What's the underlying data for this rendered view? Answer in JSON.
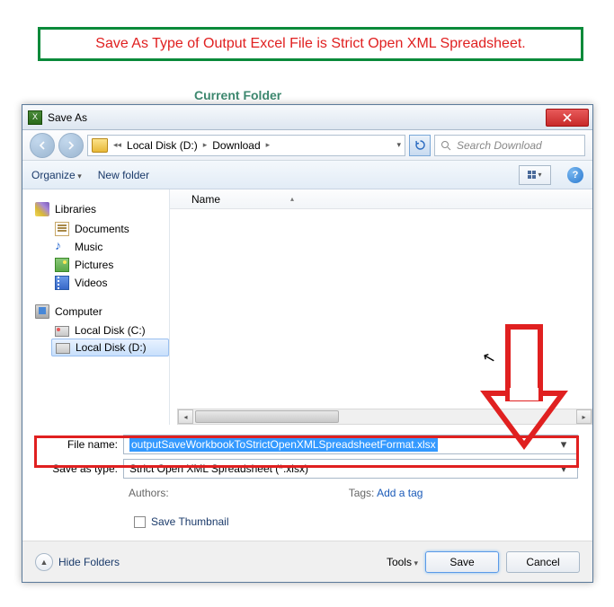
{
  "annotation": "Save As Type of Output Excel File is Strict Open XML Spreadsheet.",
  "bg_text": "Current Folder",
  "dialog": {
    "title": "Save As",
    "breadcrumb": {
      "parts": [
        "Local Disk (D:)",
        "Download"
      ]
    },
    "search_placeholder": "Search Download",
    "toolbar": {
      "organize": "Organize",
      "new_folder": "New folder"
    },
    "columns": {
      "name": "Name"
    },
    "nav": {
      "libraries": "Libraries",
      "documents": "Documents",
      "music": "Music",
      "pictures": "Pictures",
      "videos": "Videos",
      "computer": "Computer",
      "drive_c": "Local Disk (C:)",
      "drive_d": "Local Disk (D:)"
    },
    "form": {
      "filename_label": "File name:",
      "filename_value": "outputSaveWorkbookToStrictOpenXMLSpreadsheetFormat.xlsx",
      "savetype_label": "Save as type:",
      "savetype_value": "Strict Open XML Spreadsheet (*.xlsx)",
      "authors_label": "Authors:",
      "authors_value": "",
      "tags_label": "Tags:",
      "tags_value": "Add a tag",
      "thumb_label": "Save Thumbnail"
    },
    "footer": {
      "hide_folders": "Hide Folders",
      "tools": "Tools",
      "save": "Save",
      "cancel": "Cancel"
    }
  }
}
